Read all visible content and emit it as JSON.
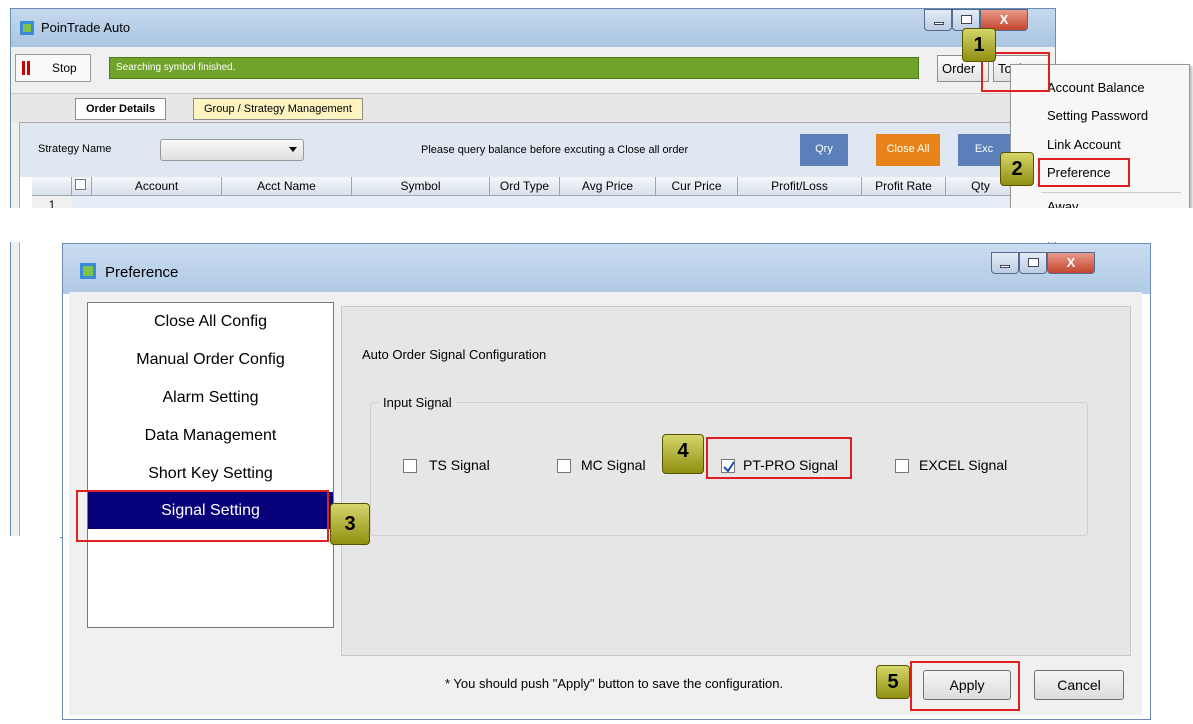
{
  "main_window": {
    "title": "PoinTrade Auto",
    "close_glyph": "X",
    "toolbar": {
      "stop_label": "Stop",
      "status_text": "Searching symbol finished.",
      "order_label": "Order",
      "tools_label": "Tools"
    },
    "tabs": [
      {
        "label": "Order Details",
        "active": true
      },
      {
        "label": "Group / Strategy Management",
        "active": false
      }
    ],
    "query_bar": {
      "strategy_label": "Strategy Name",
      "strategy_value": "",
      "message": "Please query balance before excuting a Close all order",
      "qry_label": "Qry",
      "close_all_label": "Close All",
      "excel_label": "Exc"
    },
    "grid": {
      "columns": [
        "Account",
        "Acct Name",
        "Symbol",
        "Ord Type",
        "Avg Price",
        "Cur Price",
        "Profit/Loss",
        "Profit Rate",
        "Qty"
      ],
      "rows": [
        {
          "index": "1"
        }
      ]
    }
  },
  "tools_menu": {
    "items": [
      "Account Balance",
      "Setting Password",
      "Link Account",
      "Preference",
      "Away"
    ]
  },
  "badges": [
    "1",
    "2",
    "3",
    "4",
    "5"
  ],
  "preference": {
    "title": "Preference",
    "close_glyph": "X",
    "menu": [
      "Close All Config",
      "Manual Order Config",
      "Alarm Setting",
      "Data Management",
      "Short Key Setting",
      "Signal Setting"
    ],
    "selected_index": 5,
    "section_title": "Auto Order Signal Configuration",
    "group_title": "Input Signal",
    "signals": [
      {
        "label": "TS Signal",
        "checked": false
      },
      {
        "label": "MC Signal",
        "checked": false
      },
      {
        "label": "PT-PRO Signal",
        "checked": true
      },
      {
        "label": "EXCEL Signal",
        "checked": false
      }
    ],
    "footer_note": "* You should  push \"Apply\" button to save the configuration.",
    "apply_label": "Apply",
    "cancel_label": "Cancel"
  },
  "colors": {
    "status_green": "#6fa32a",
    "qry_blue": "#5b7fb8",
    "close_all_orange": "#e8831a",
    "selected_navy": "#08007a",
    "highlight_red": "#e02020",
    "badge_olive": "#a0a020"
  }
}
